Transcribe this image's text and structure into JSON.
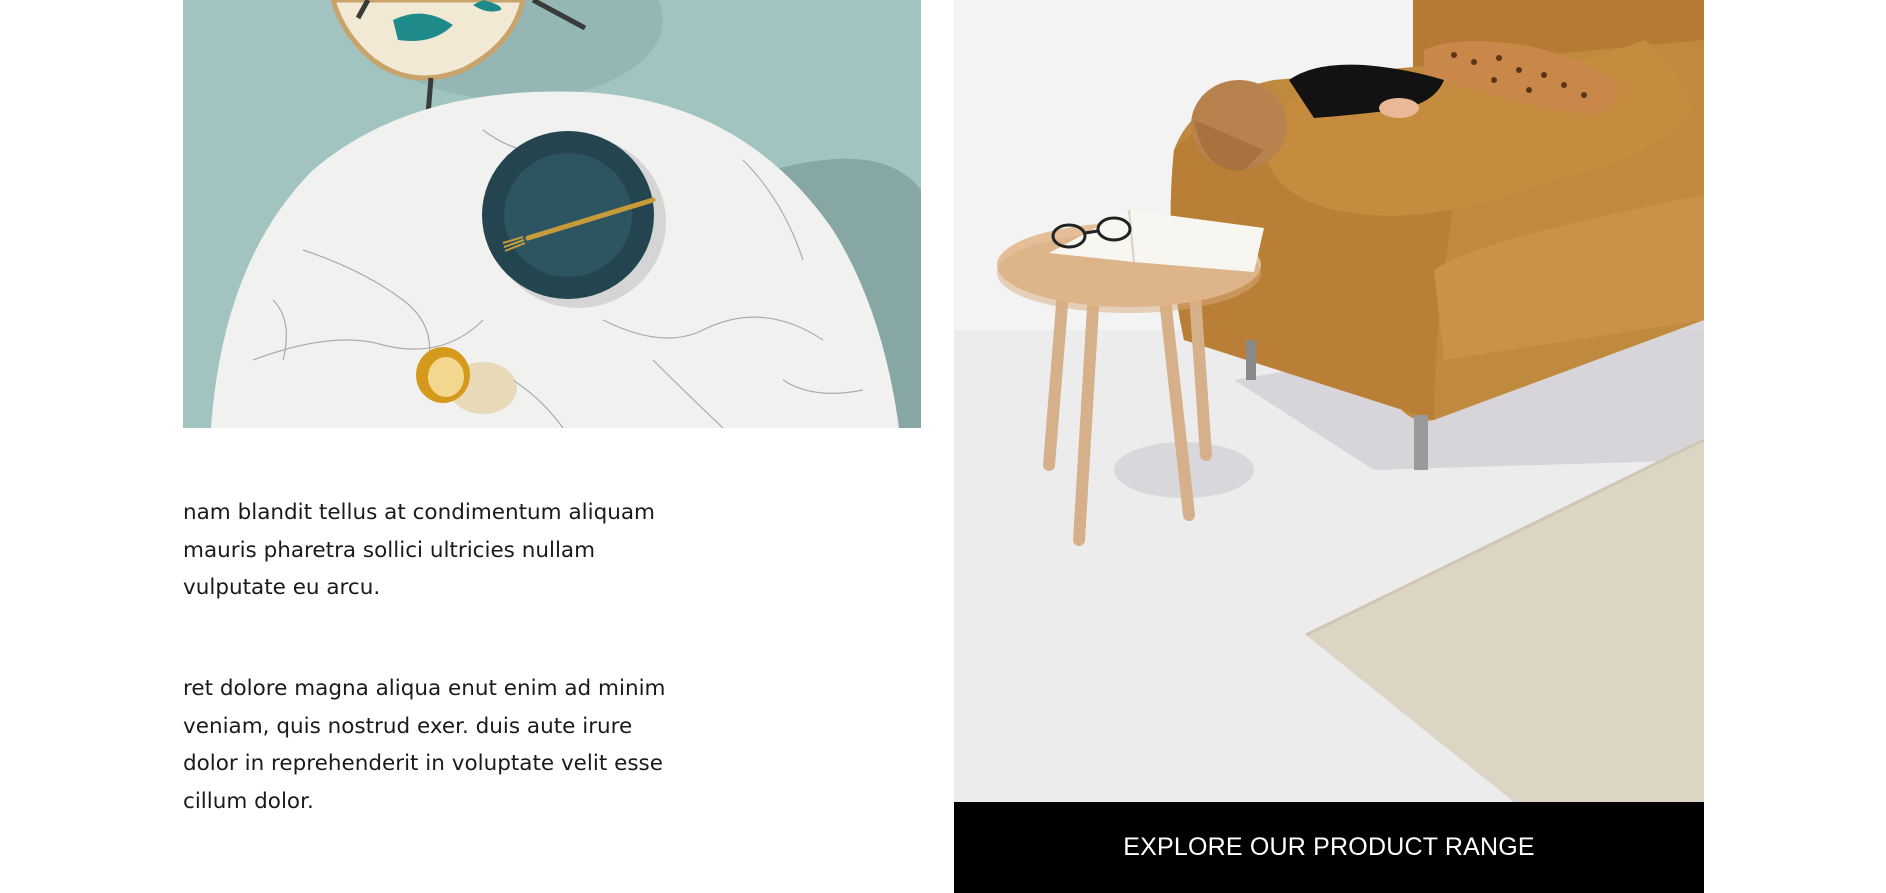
{
  "content": {
    "paragraph_1": "nam blandit tellus at condimentum aliquam mauris pharetra sollici ultricies nullam vulputate eu arcu.",
    "paragraph_2": "ret dolore magna aliqua enut enim ad minim veniam, quis nostrud exer. duis aute irure dolor in reprehenderit in voluptate velit esse cillum dolor."
  },
  "cta": {
    "label": "EXPLORE OUR PRODUCT RANGE"
  },
  "images": {
    "left": "marble-dining-table-photo",
    "right": "mustard-sofa-side-table-photo"
  },
  "colors": {
    "background": "#ffffff",
    "text": "#1a1a1a",
    "cta_background": "#000000",
    "cta_text": "#ffffff",
    "teal_backdrop": "#a3c4c2",
    "sofa_mustard": "#c08a3e"
  }
}
